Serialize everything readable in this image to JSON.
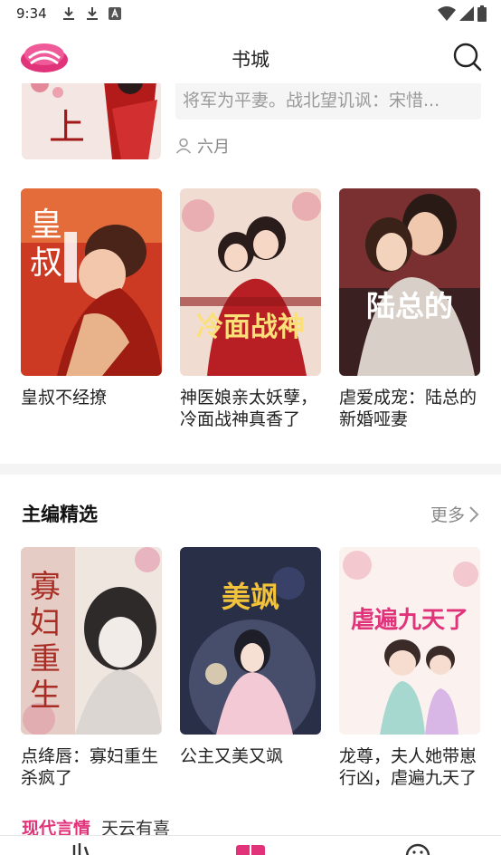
{
  "status_bar": {
    "time": "9:34",
    "notification_icons": [
      "download-icon",
      "download-icon",
      "accessibility-icon"
    ],
    "system_icons": [
      "wifi-icon",
      "signal-icon",
      "battery-icon"
    ]
  },
  "header": {
    "title": "书城",
    "logo_icon": "app-logo-icon",
    "search_icon": "search-icon"
  },
  "prev_item": {
    "description": "将军为平妻。战北望讥讽：宋惜...",
    "author": "六月",
    "cover_text": "上"
  },
  "row1_books": [
    {
      "title": "皇叔不经撩",
      "cover_text": "皇叔"
    },
    {
      "title": "神医娘亲太妖孽，冷面战神真香了",
      "cover_text": "冷面战神"
    },
    {
      "title": "虐爱成宠：陆总的新婚哑妻",
      "cover_text": "陆总的"
    }
  ],
  "section": {
    "title": "主编精选",
    "more_label": "更多"
  },
  "row2_books": [
    {
      "title": "点绛唇：寡妇重生杀疯了",
      "cover_text": "寡妇重生"
    },
    {
      "title": "公主又美又飒",
      "cover_text": "美飒"
    },
    {
      "title": "龙尊，夫人她带崽行凶，虐遍九天了",
      "cover_text": "虐遍九天了"
    }
  ],
  "categories": {
    "active": "现代言情",
    "next": "天云有喜"
  },
  "bottom_nav": [
    "bookshelf-icon",
    "bookstore-icon",
    "profile-icon"
  ],
  "colors": {
    "accent": "#e0337a"
  }
}
